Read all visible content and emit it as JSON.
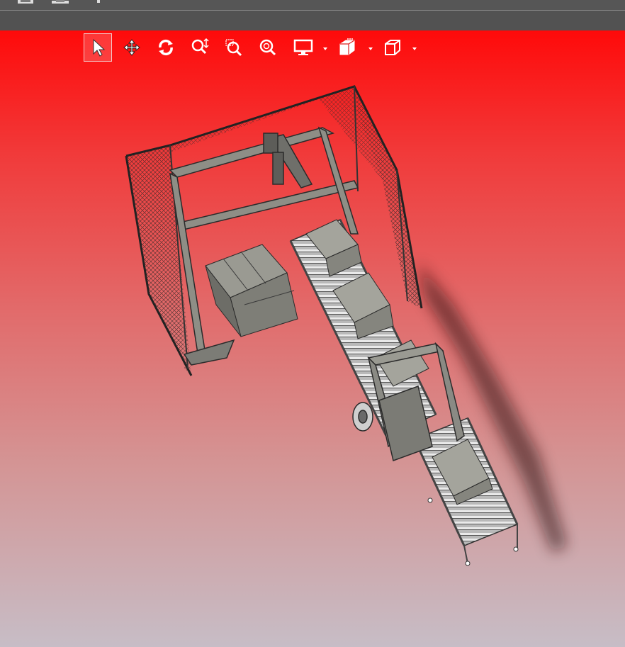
{
  "window": {
    "top_icons": [
      "save-icon",
      "print-icon",
      "menu-icon"
    ]
  },
  "toolbar": {
    "tools": [
      {
        "name": "select-tool",
        "icon": "arrow-pointer-icon",
        "active": true
      },
      {
        "name": "pan-tool",
        "icon": "move-arrows-icon"
      },
      {
        "name": "rotate-tool",
        "icon": "rotate-icon"
      },
      {
        "name": "zoom-tool",
        "icon": "zoom-vertical-icon"
      },
      {
        "name": "zoom-window-tool",
        "icon": "zoom-window-icon"
      },
      {
        "name": "zoom-fit-tool",
        "icon": "zoom-fit-icon"
      },
      {
        "name": "display-mode-tool",
        "icon": "monitor-icon",
        "dropdown": true
      },
      {
        "name": "section-view-tool",
        "icon": "section-cube-icon",
        "dropdown": true
      },
      {
        "name": "view-orientation-tool",
        "icon": "cube-icon",
        "dropdown": true
      }
    ]
  },
  "viewport": {
    "gradient_top": "#ff0a0a",
    "gradient_bottom": "#c7bdc6",
    "model": "palletizing-cell-with-conveyors"
  }
}
